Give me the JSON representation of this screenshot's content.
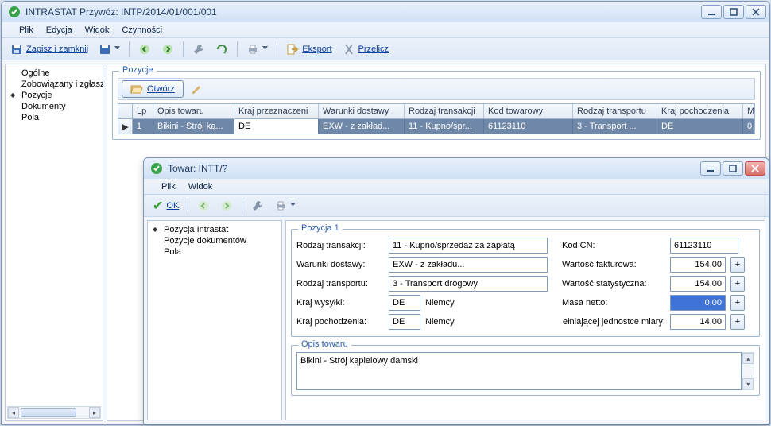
{
  "mainWindow": {
    "title": "INTRASTAT Przywóz: INTP/2014/01/001/001",
    "menu": {
      "file": "Plik",
      "edit": "Edycja",
      "view": "Widok",
      "actions": "Czynności"
    },
    "toolbar": {
      "saveClose": "Zapisz i zamknij",
      "export": "Eksport",
      "recalc": "Przelicz"
    },
    "sidebar": {
      "items": [
        "Ogólne",
        "Zobowiązany i zgłaszaj",
        "Pozycje",
        "Dokumenty",
        "Pola"
      ],
      "activeIndex": 2
    },
    "positionsGroup": {
      "legend": "Pozycje",
      "openBtn": "Otwórz",
      "columns": [
        "Lp",
        "Opis towaru",
        "Kraj przeznaczeni",
        "Warunki dostawy",
        "Rodzaj transakcji",
        "Kod towarowy",
        "Rodzaj transportu",
        "Kraj pochodzenia",
        "M"
      ],
      "row": {
        "lp": "1",
        "opis": "Bikini - Strój ką...",
        "krajPrzezn": "DE",
        "warunki": "EXW - z zakład...",
        "rodzajTrans": "11 - Kupno/spr...",
        "kodTow": "61123110",
        "rodzajTransp": "3 - Transport ...",
        "krajPoch": "DE",
        "m": "0"
      }
    }
  },
  "childWindow": {
    "title": "Towar: INTT/?",
    "menu": {
      "file": "Plik",
      "view": "Widok"
    },
    "toolbar": {
      "ok": "OK"
    },
    "sidebar": {
      "items": [
        "Pozycja Intrastat",
        "Pozycje dokumentów",
        "Pola"
      ],
      "activeIndex": 0
    },
    "form": {
      "groupLegend": "Pozycja 1",
      "labels": {
        "rodzajTransakcji": "Rodzaj transakcji:",
        "warunkiDostawy": "Warunki dostawy:",
        "rodzajTransportu": "Rodzaj transportu:",
        "krajWysylki": "Kraj wysyłki:",
        "krajPochodzenia": "Kraj pochodzenia:",
        "kodCN": "Kod CN:",
        "wartoscFakturowa": "Wartość fakturowa:",
        "wartoscStatystyczna": "Wartość statystyczna:",
        "masaNetto": "Masa netto:",
        "jednostka": "ełniającej jednostce miary:"
      },
      "values": {
        "rodzajTransakcji": "11 - Kupno/sprzedaż za zapłatą",
        "warunkiDostawy": "EXW - z zakładu...",
        "rodzajTransportu": "3 - Transport drogowy",
        "krajWysylkiCode": "DE",
        "krajWysylkiName": "Niemcy",
        "krajPochodzeniaCode": "DE",
        "krajPochodzeniaName": "Niemcy",
        "kodCN": "61123110",
        "wartoscFakturowa": "154,00",
        "wartoscStatystyczna": "154,00",
        "masaNetto": "0,00",
        "jednostka": "14,00"
      },
      "descLegend": "Opis towaru",
      "descValue": "Bikini - Strój kąpielowy damski"
    }
  }
}
